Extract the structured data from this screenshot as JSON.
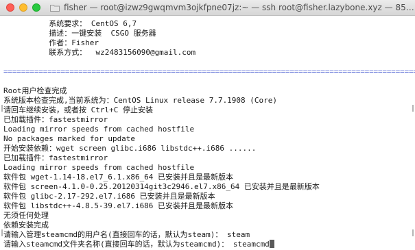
{
  "window": {
    "title": "fisher — root@izwz9gwqmvm3ojkfpne07jz:~ — ssh root@fisher.lazybone.xyz — 85…"
  },
  "terminal": {
    "info_lines": [
      "          系统要求： CentOS 6,7",
      "          描述：一键安装  CSGO 服务器",
      "          作者：Fisher",
      "          联系方式：  wz2483156090@gmail.com"
    ],
    "separator": "================================================================================================",
    "output_lines": [
      "Root用户检查完成",
      "系统版本检查完成,当前系统为：CentOS Linux release 7.7.1908 (Core)",
      "请回车继续安装，或者按 Ctrl+C 停止安装",
      "已加载插件：fastestmirror",
      "Loading mirror speeds from cached hostfile",
      "No packages marked for update",
      "开始安装依赖：wget screen glibc.i686 libstdc++.i686 ......",
      "已加载插件：fastestmirror",
      "Loading mirror speeds from cached hostfile",
      "软件包 wget-1.14-18.el7_6.1.x86_64 已安装并且是最新版本",
      "软件包 screen-4.1.0-0.25.20120314git3c2946.el7.x86_64 已安装并且是最新版本",
      "软件包 glibc-2.17-292.el7.i686 已安装并且是最新版本",
      "软件包 libstdc++-4.8.5-39.el7.i686 已安装并且是最新版本",
      "无须任何处理",
      "依赖安装完成",
      "请输入管理steamcmd的用户名(直接回车的话，默认为steam)： steam"
    ],
    "prompt_line": "请输入steamcmd文件夹名称(直接回车的话，默认为steamcmd)： steamcmd"
  },
  "colors": {
    "separator": "#5a6cd6",
    "text": "#1a1a1a",
    "close": "#ff5f57",
    "minimize": "#ffbd2e",
    "maximize": "#28c940"
  },
  "icons": {
    "close": "close-button",
    "minimize": "minimize-button",
    "maximize": "zoom-button",
    "title": "folder-icon"
  }
}
